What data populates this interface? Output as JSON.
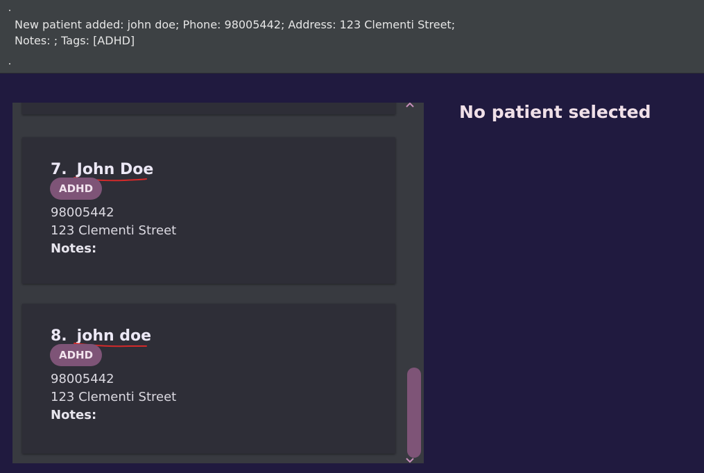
{
  "result_display": {
    "text": "New patient added: john doe; Phone: 98005442; Address: 123 Clementi Street;\nNotes: ; Tags: [ADHD]"
  },
  "patient_list": {
    "items": [
      {
        "index": "7.",
        "name": "John Doe",
        "tags": [
          "ADHD"
        ],
        "phone": "98005442",
        "address": "123 Clementi Street",
        "notes_label": "Notes:"
      },
      {
        "index": "8.",
        "name": "john doe",
        "tags": [
          "ADHD"
        ],
        "phone": "98005442",
        "address": "123 Clementi Street",
        "notes_label": "Notes:"
      }
    ],
    "scroll_icons": [
      "chevron-up-icon",
      "chevron-down-icon"
    ]
  },
  "detail_panel": {
    "placeholder": "No patient selected"
  },
  "colors": {
    "background": "#201a3f",
    "result_box": "#3d4144",
    "card": "#2e2e37",
    "tag": "#7e5477",
    "annotation_underline": "#d42a2a"
  }
}
